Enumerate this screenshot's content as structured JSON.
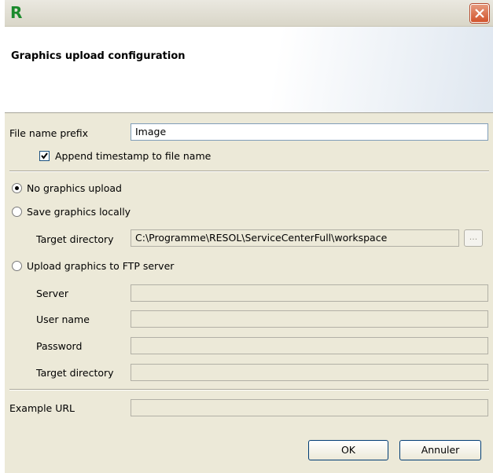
{
  "window": {
    "app_icon": "R",
    "close_icon": "close-icon"
  },
  "banner": {
    "title": "Graphics upload configuration"
  },
  "prefix": {
    "label": "File name prefix",
    "value": "Image"
  },
  "timestamp": {
    "label": "Append timestamp to file name",
    "checked": true
  },
  "options": {
    "no_upload": "No graphics upload",
    "save_locally": "Save graphics locally",
    "ftp": "Upload graphics to FTP server",
    "selected": "no_upload"
  },
  "local": {
    "target_label": "Target directory",
    "target_value": "C:\\Programme\\RESOL\\ServiceCenterFull\\workspace",
    "browse_label": "..."
  },
  "ftp": {
    "server_label": "Server",
    "server_value": "",
    "user_label": "User name",
    "user_value": "",
    "password_label": "Password",
    "password_value": "",
    "target_label": "Target directory",
    "target_value": ""
  },
  "example": {
    "label": "Example URL",
    "value": ""
  },
  "buttons": {
    "ok": "OK",
    "cancel": "Annuler"
  },
  "colors": {
    "dialog_bg": "#ece9d8",
    "close_red": "#d2532c",
    "icon_green": "#1a8a2c"
  }
}
